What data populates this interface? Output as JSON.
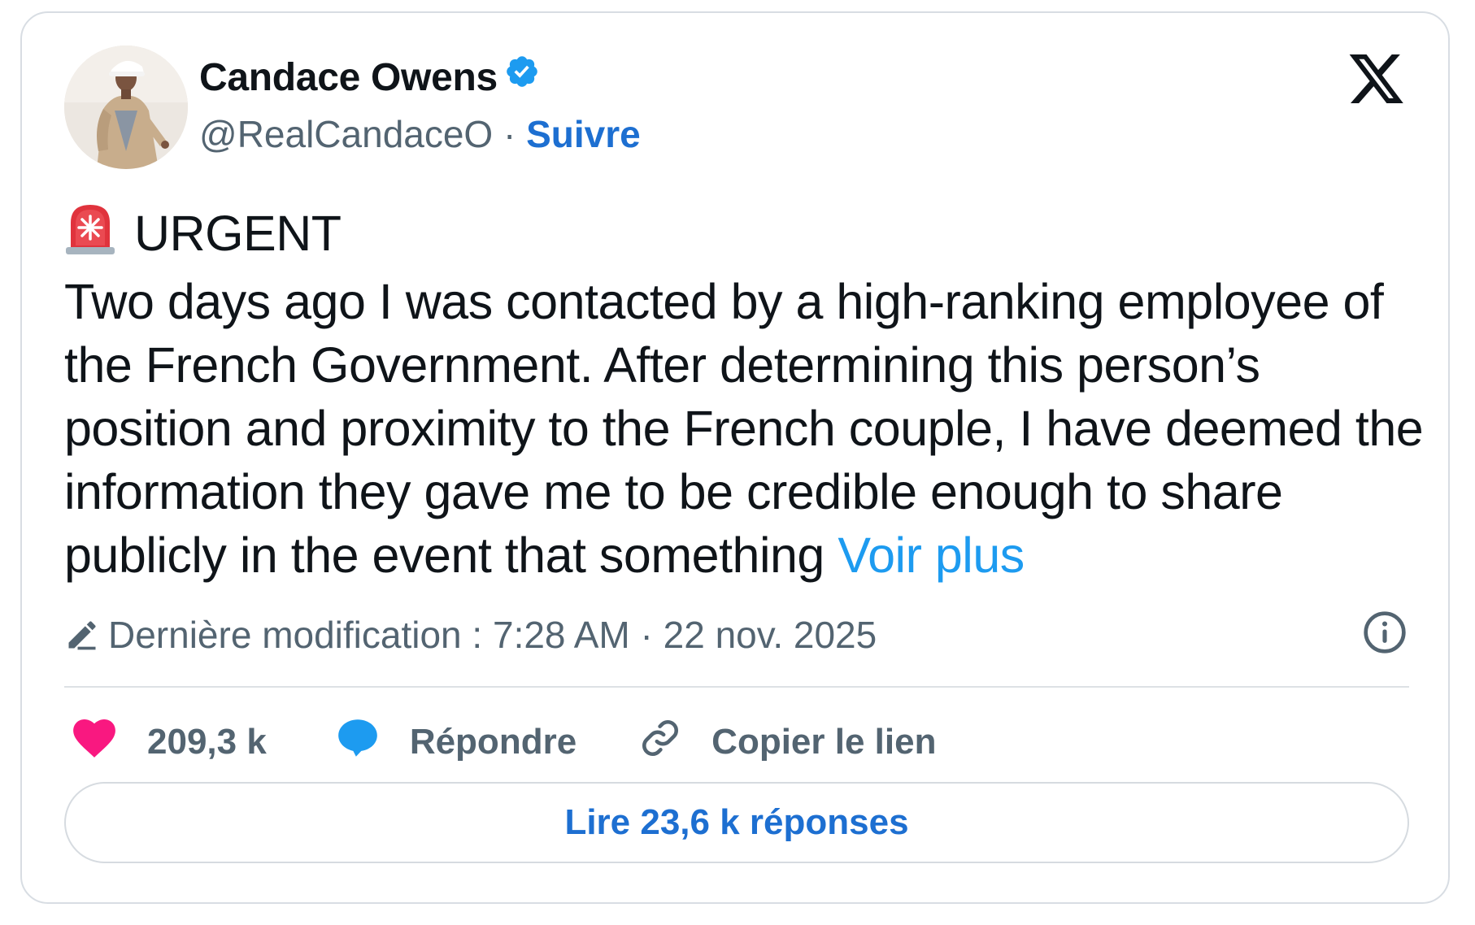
{
  "author": {
    "name": "Candace Owens",
    "handle": "@RealCandaceO",
    "separator": " · ",
    "follow_label": "Suivre",
    "verified_icon": "verified-badge-icon",
    "avatar_icon": "profile-photo"
  },
  "platform_logo": "x-logo-icon",
  "tweet": {
    "emoji": "rotating-light-emoji",
    "heading": "URGENT",
    "body": "Two days ago I was contacted by a high-ranking employee of the French Government. After determining this person’s position and proximity to the French couple, I have deemed the information they gave me to be credible enough to share publicly in the event that something ",
    "see_more_label": "Voir plus"
  },
  "edited": {
    "icon": "pencil-icon",
    "text": "Dernière modification : 7:28 AM · 22 nov. 2025",
    "info_icon": "info-icon"
  },
  "actions": {
    "likes": {
      "icon": "heart-icon",
      "label": "209,3 k"
    },
    "reply": {
      "icon": "speech-bubble-icon",
      "label": "Répondre"
    },
    "copy_link": {
      "icon": "link-icon",
      "label": "Copier le lien"
    }
  },
  "read_replies_label": "Lire 23,6 k réponses",
  "colors": {
    "text": "#0f1419",
    "secondary": "#536471",
    "link_blue": "#1d9bf0",
    "follow_blue": "#1d6fd1",
    "heart_pink": "#f91880",
    "border": "#d8dde3"
  }
}
